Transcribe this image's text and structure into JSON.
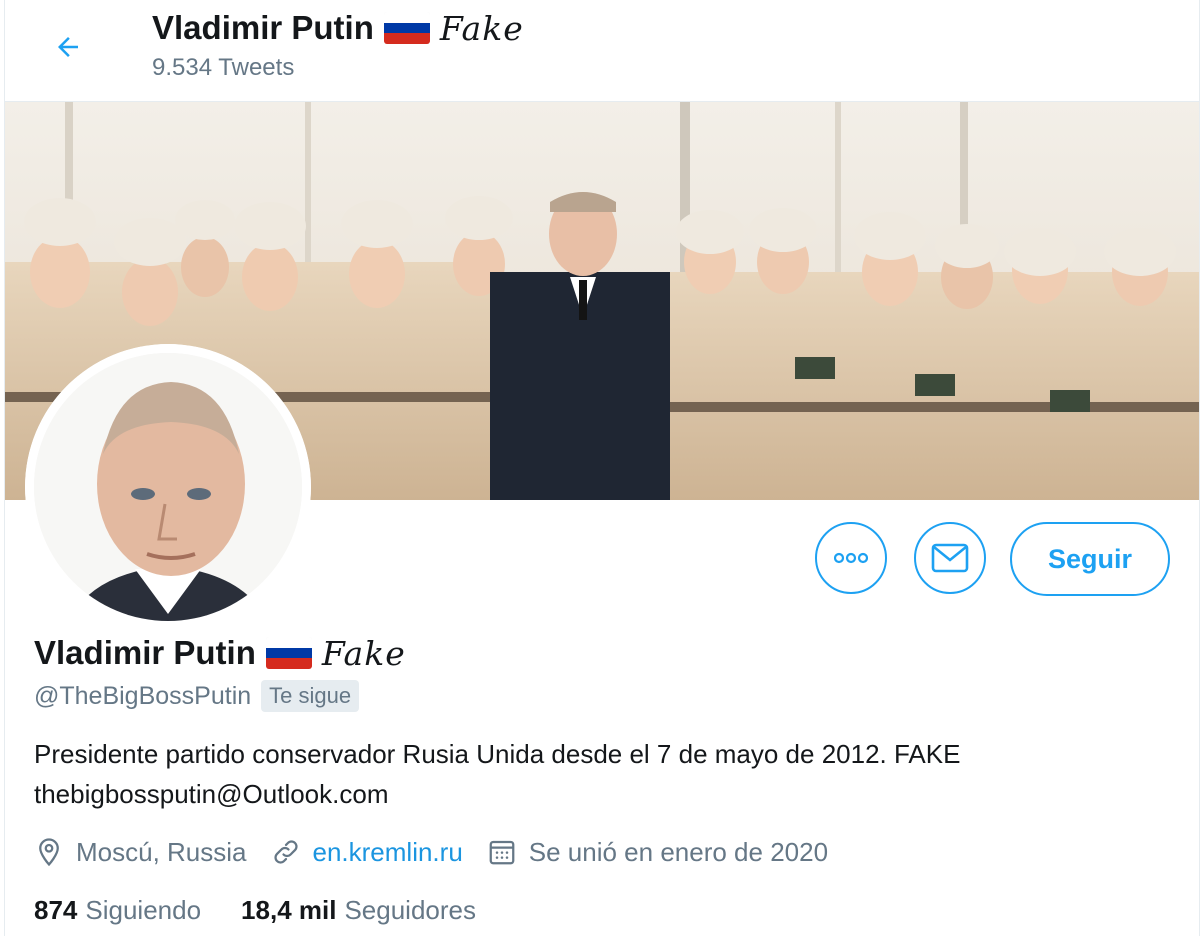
{
  "header": {
    "name": "Vladimir Putin",
    "fake_label": "Fake",
    "tweet_count": "9.534 Tweets"
  },
  "profile": {
    "name": "Vladimir Putin",
    "fake_label": "Fake",
    "handle": "@TheBigBossPutin",
    "follows_you": "Te sigue",
    "bio_line1": "Presidente partido conservador Rusia Unida desde el 7 de mayo de 2012. FAKE",
    "bio_line2": "thebigbossputin@Outlook.com",
    "location": "Moscú, Russia",
    "website": "en.kremlin.ru",
    "joined": "Se unió en enero de 2020"
  },
  "actions": {
    "follow_label": "Seguir"
  },
  "stats": {
    "following_count": "874",
    "following_label": "Siguiendo",
    "followers_count": "18,4 mil",
    "followers_label": "Seguidores"
  },
  "icons": {
    "back": "arrow-left-icon",
    "more": "more-icon",
    "message": "envelope-icon",
    "location": "location-pin-icon",
    "link": "link-icon",
    "calendar": "calendar-icon",
    "flag": "russia-flag-icon"
  },
  "colors": {
    "accent": "#1da1f2",
    "link": "#1b95e0",
    "secondary_text": "#657786",
    "flag_white": "#ffffff",
    "flag_blue": "#0039a6",
    "flag_red": "#d52b1e"
  }
}
